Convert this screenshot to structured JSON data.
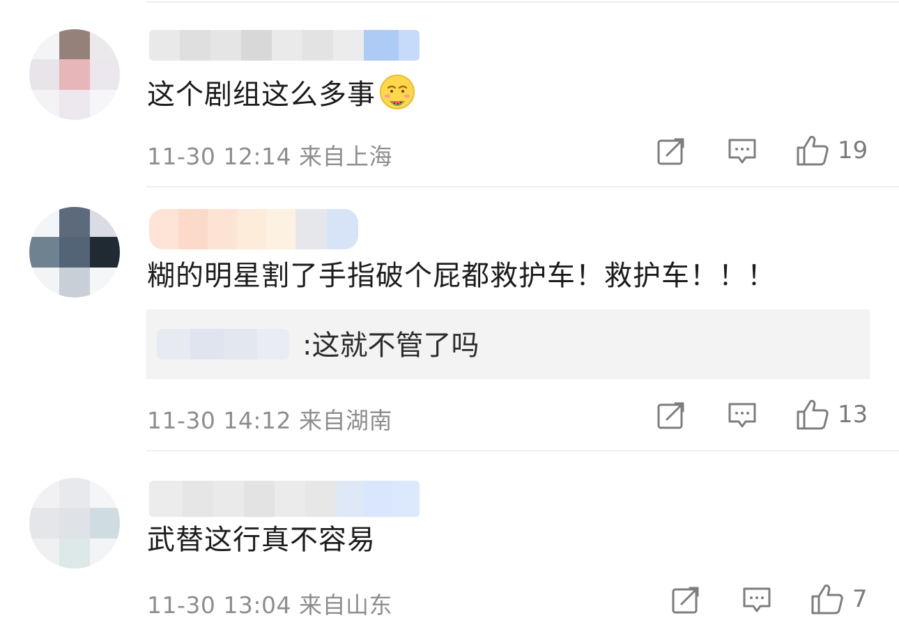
{
  "comments": [
    {
      "text": "这个剧组这么多事",
      "emoji": "smirking-face-watermelon-emoji",
      "date": "11-30",
      "time": "12:14",
      "location": "来自上海",
      "likes": "19"
    },
    {
      "text": "糊的明星割了手指破个屁都救护车！救护车！！！",
      "reply": {
        "text": ":这就不管了吗"
      },
      "date": "11-30",
      "time": "14:12",
      "location": "来自湖南",
      "likes": "13"
    },
    {
      "text": "武替这行真不容易",
      "date": "11-30",
      "time": "13:04",
      "location": "来自山东",
      "likes": "7"
    }
  ],
  "icons": {
    "share": "share-icon",
    "comment": "comment-icon",
    "like": "thumbs-up-icon"
  },
  "colors": {
    "meta_text": "#8d8d8d",
    "icon": "#7d7d7d",
    "reply_bg": "#f3f3f3"
  }
}
